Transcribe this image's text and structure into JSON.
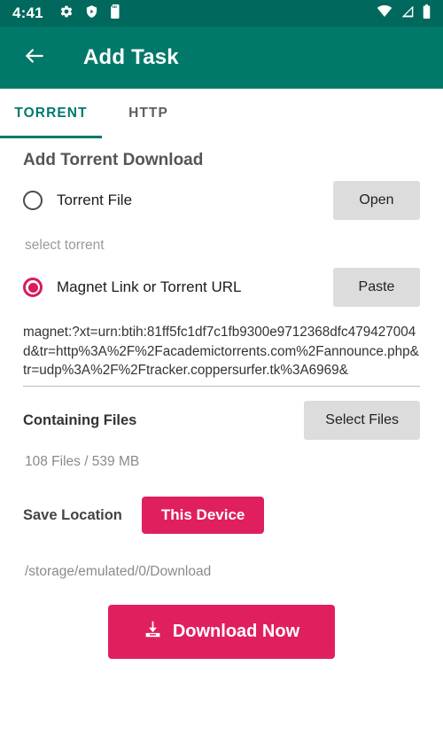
{
  "status_bar": {
    "time": "4:41",
    "left_icons": [
      "gear-icon",
      "shield-play-icon",
      "sd-card-icon"
    ],
    "right_icons": [
      "wifi-icon",
      "cellular-signal-icon",
      "battery-icon"
    ],
    "background": "#00685c"
  },
  "toolbar": {
    "back_icon": "arrow-left-icon",
    "title": "Add Task",
    "background": "#00796b"
  },
  "tabs": [
    {
      "label": "TORRENT",
      "active": true
    },
    {
      "label": "HTTP",
      "active": false
    }
  ],
  "main": {
    "section_title": "Add Torrent Download",
    "torrent_file": {
      "label": "Torrent File",
      "selected": false,
      "button": "Open"
    },
    "select_torrent_hint": "select torrent",
    "magnet": {
      "label": "Magnet Link or Torrent URL",
      "selected": true,
      "button": "Paste",
      "value": "magnet:?xt=urn:btih:81ff5fc1df7c1fb9300e9712368dfc479427004d&tr=http%3A%2F%2Facademictorrents.com%2Fannounce.php&tr=udp%3A%2F%2Ftracker.coppersurfer.tk%3A6969&"
    },
    "containing_files": {
      "label": "Containing Files",
      "button": "Select Files",
      "info": "108 Files / 539 MB"
    },
    "save_location": {
      "label": "Save Location",
      "button": "This Device",
      "path": "/storage/emulated/0/Download"
    },
    "download_button": {
      "label": "Download Now",
      "icon": "download-icon"
    }
  },
  "colors": {
    "primary": "#00796b",
    "primary_dark": "#00685c",
    "accent": "#e01f5e",
    "radio_accent": "#d81b60",
    "button_gray": "#dcdcdc"
  }
}
